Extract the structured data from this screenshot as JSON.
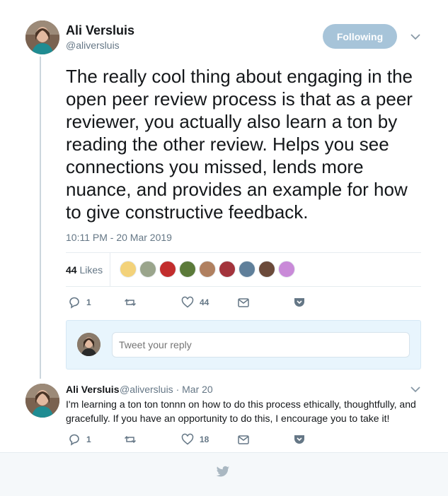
{
  "main_tweet": {
    "author_name": "Ali Versluis",
    "author_handle": "@aliversluis",
    "follow_button_label": "Following",
    "text": "The really cool thing about engaging in the open peer review process is that as a peer reviewer, you actually also learn a ton by reading the other review. Helps you see connections you missed, lends more nuance, and provides an example for how to give constructive feedback.",
    "timestamp": "10:11 PM - 20 Mar 2019",
    "likes_count": "44",
    "likes_label": "Likes",
    "liker_avatar_colors": [
      "#f3d27a",
      "#9aa58c",
      "#c22d2d",
      "#5b7a3a",
      "#b08060",
      "#a3343c",
      "#5f7f9a",
      "#6b4a3a",
      "#c98ad8"
    ],
    "reply_count": "1",
    "retweet_count": "",
    "like_count": "44"
  },
  "reply_box": {
    "placeholder": "Tweet your reply"
  },
  "reply_tweet": {
    "author_name": "Ali Versluis",
    "author_handle_date": "@aliversluis · Mar 20",
    "text": "I'm learning a ton ton tonnn on how to do this process ethically, thoughtfully, and gracefully. If you have an opportunity to do this, I encourage you to take it!",
    "reply_count": "1",
    "like_count": "18"
  },
  "colors": {
    "follow_button": "#a7c4d9",
    "icon_gray": "#657786",
    "reply_box_bg": "#e8f5fd"
  }
}
